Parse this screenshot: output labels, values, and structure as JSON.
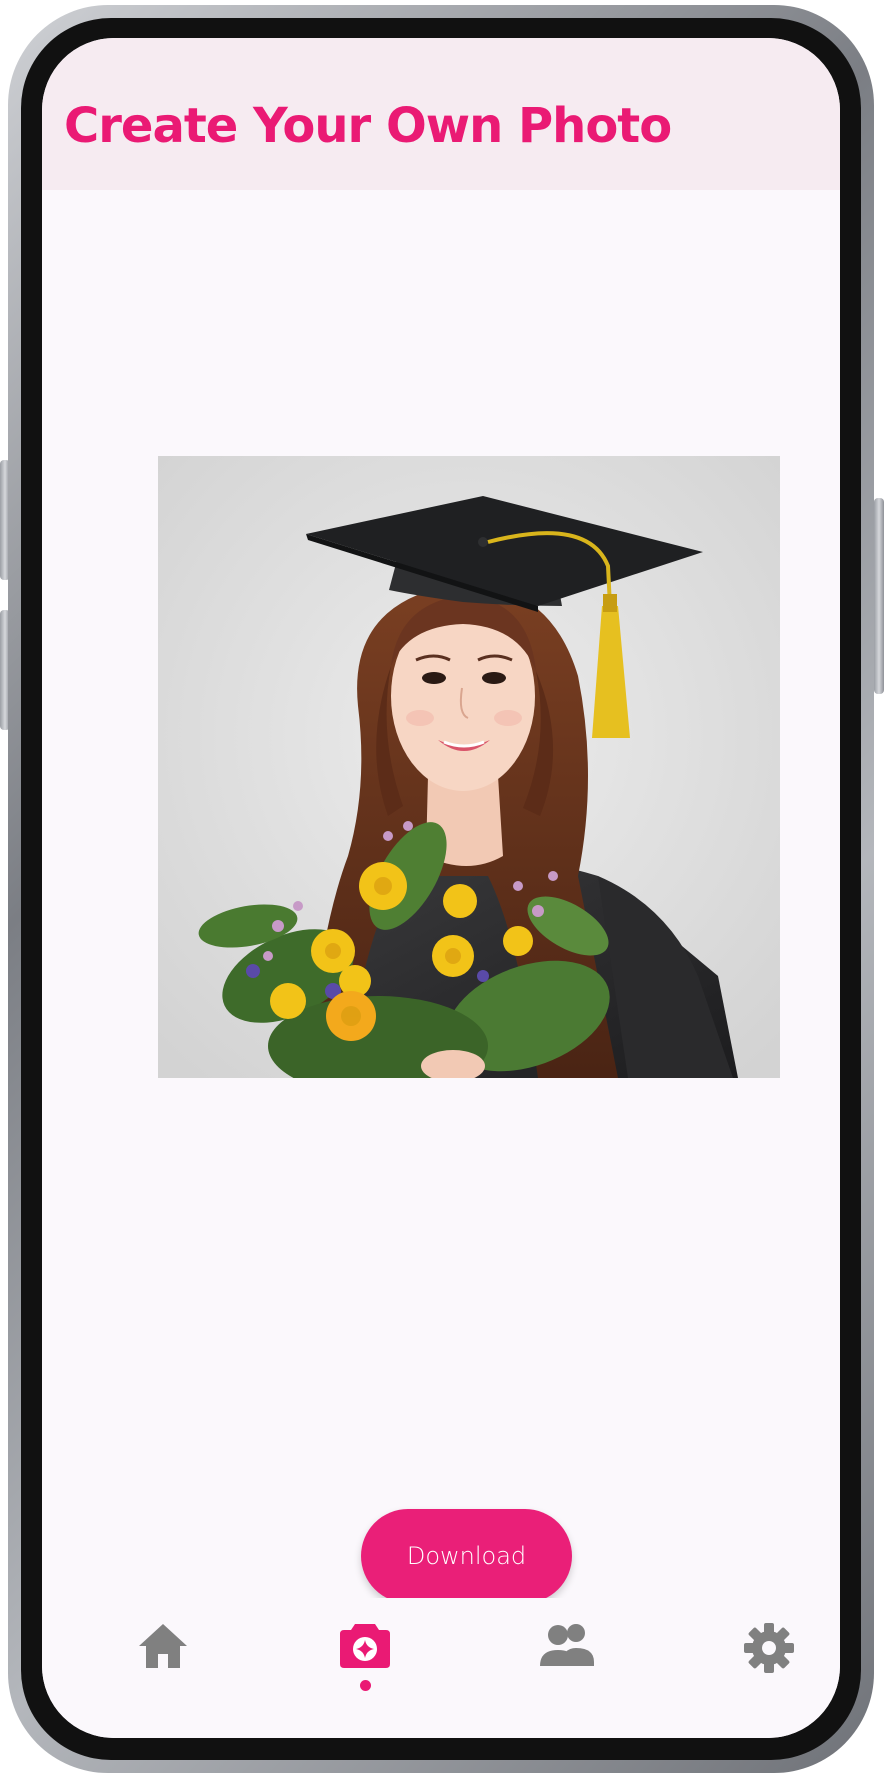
{
  "app": {
    "title": "Create Your Own Photo"
  },
  "photo": {
    "alt": "Graduation portrait of a young woman in a cap and gown holding a bouquet of yellow flowers"
  },
  "actions": {
    "download_label": "Download"
  },
  "nav": {
    "items": [
      {
        "id": "home",
        "icon": "home-icon",
        "active": false
      },
      {
        "id": "create",
        "icon": "camera-icon",
        "active": true
      },
      {
        "id": "people",
        "icon": "people-icon",
        "active": false
      },
      {
        "id": "settings",
        "icon": "gear-icon",
        "active": false
      }
    ]
  },
  "colors": {
    "accent": "#ea1a74",
    "header_bg": "#f6ebf1",
    "screen_bg": "#fbf8fc",
    "nav_inactive": "#808080"
  }
}
